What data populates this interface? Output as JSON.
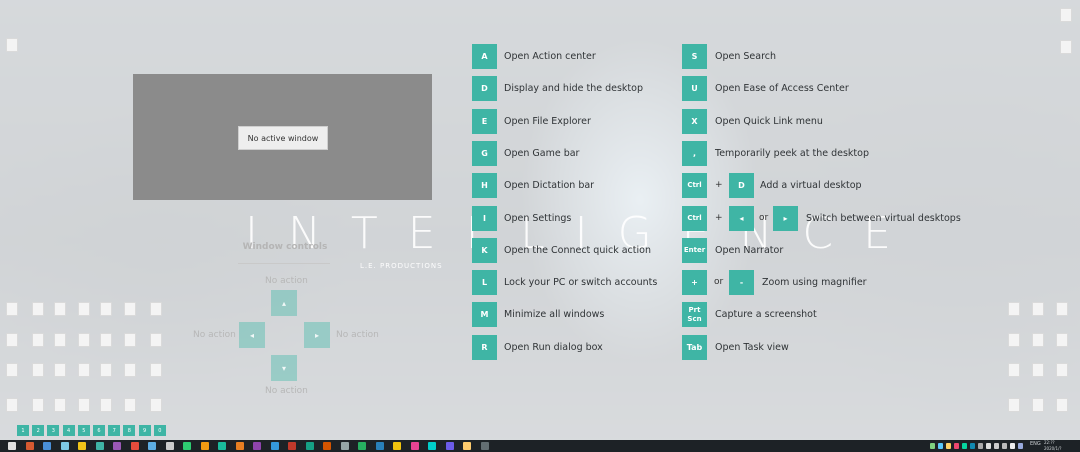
{
  "background_art": {
    "title": "INTELLIGENCE",
    "subtitle": "L.E. PRODUCTIONS"
  },
  "window_preview": {
    "label": "No active window"
  },
  "window_controls": {
    "heading": "Window controls",
    "up_action": "No action",
    "left_action": "No action",
    "right_action": "No action",
    "down_action": "No action"
  },
  "shortcuts_left": [
    {
      "key": "A",
      "action": "Open Action center"
    },
    {
      "key": "D",
      "action": "Display and hide the desktop"
    },
    {
      "key": "E",
      "action": "Open File Explorer"
    },
    {
      "key": "G",
      "action": "Open Game bar"
    },
    {
      "key": "H",
      "action": "Open Dictation bar"
    },
    {
      "key": "I",
      "action": "Open Settings"
    },
    {
      "key": "K",
      "action": "Open the Connect quick action"
    },
    {
      "key": "L",
      "action": "Lock your PC or switch accounts"
    },
    {
      "key": "M",
      "action": "Minimize all windows"
    },
    {
      "key": "R",
      "action": "Open Run dialog box"
    }
  ],
  "shortcuts_right": [
    {
      "key": "S",
      "action": "Open Search"
    },
    {
      "key": "U",
      "action": "Open Ease of Access Center"
    },
    {
      "key": "X",
      "action": "Open Quick Link menu"
    },
    {
      "key": ",",
      "action": "Temporarily peek at the desktop"
    },
    {
      "key": "Ctrl",
      "plus": "+",
      "key2": "D",
      "action": "Add a virtual desktop"
    },
    {
      "key": "Ctrl",
      "plus": "+",
      "key2": "◂",
      "or": "or",
      "key3": "▸",
      "action": "Switch between virtual desktops"
    },
    {
      "key": "Enter",
      "action": "Open Narrator"
    },
    {
      "key": "+",
      "or": "or",
      "key2": "-",
      "action": "Zoom using magnifier"
    },
    {
      "key": "Prt Scn",
      "action": "Capture a screenshot"
    },
    {
      "key": "Tab",
      "action": "Open Task view"
    }
  ],
  "virtual_desktops": [
    "1",
    "2",
    "3",
    "4",
    "5",
    "6",
    "7",
    "8",
    "9",
    "0"
  ],
  "taskbar": {
    "language": "ENG",
    "time": "22:??",
    "date": "2020/1/?"
  },
  "colors": {
    "accent": "#3fb5a5",
    "taskbar": "#1d2226"
  }
}
